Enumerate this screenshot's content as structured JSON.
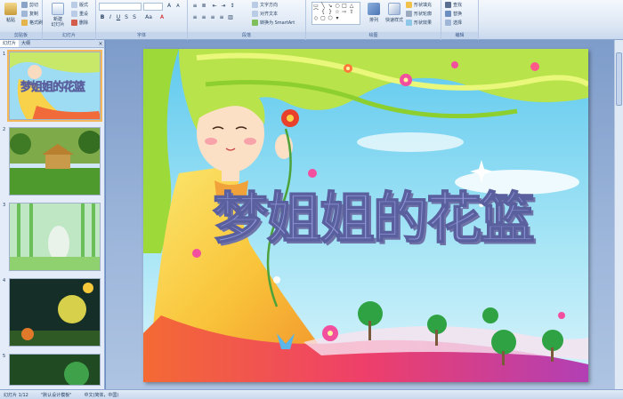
{
  "ribbon": {
    "clipboard": {
      "label": "剪贴板",
      "paste": "粘贴",
      "cut": "剪切",
      "copy": "复制",
      "format_painter": "格式刷"
    },
    "slides": {
      "label": "幻灯片",
      "new_slide": "新建\n幻灯片",
      "layout": "版式",
      "reset": "重设",
      "delete": "删除"
    },
    "font": {
      "label": "字体",
      "font_name": "",
      "font_size": ""
    },
    "paragraph": {
      "label": "段落",
      "text_direction": "文字方向",
      "align_text": "对齐文本",
      "convert_smartart": "转换为 SmartArt"
    },
    "drawing": {
      "label": "绘图",
      "arrange": "排列",
      "quick_styles": "快速样式",
      "shape_fill": "形状填充",
      "shape_outline": "形状轮廓",
      "shape_effects": "形状效果"
    },
    "editing": {
      "label": "编辑",
      "find": "查找",
      "replace": "替换",
      "select": "选择"
    }
  },
  "left_panel": {
    "tabs": [
      "幻灯片",
      "大纲"
    ],
    "close": "×",
    "thumbnails": [
      {
        "number": "1",
        "title": "梦姐姐的花篮"
      },
      {
        "number": "2"
      },
      {
        "number": "3"
      },
      {
        "number": "4"
      },
      {
        "number": "5"
      }
    ]
  },
  "slide": {
    "title": "梦姐姐的花篮"
  },
  "statusbar": {
    "slide_info": "幻灯片 1/12",
    "theme": "\"默认设计模板\"",
    "language": "中文(简体，中国)"
  },
  "colors": {
    "ribbon_bg": "#dbe6f4",
    "title_fill": "#8e95d6",
    "title_stroke": "#5a5f9e",
    "sky": "#7fd6f2"
  }
}
